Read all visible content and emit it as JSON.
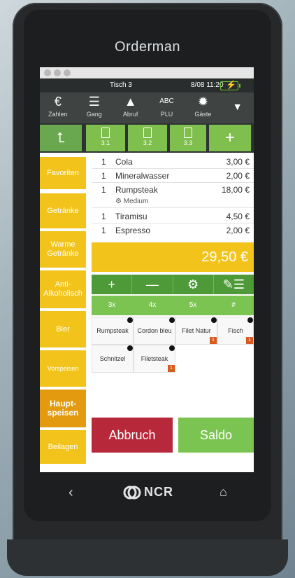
{
  "device": {
    "brand": "Orderman"
  },
  "status": {
    "table": "Tisch 3",
    "time": "8/08  11:20"
  },
  "toolbar": [
    {
      "label": "Zahlen",
      "icon": "euro-icon",
      "glyph": "€"
    },
    {
      "label": "Gang",
      "icon": "list-icon",
      "glyph": "☰"
    },
    {
      "label": "Abruf",
      "icon": "bell-icon",
      "glyph": "🛎"
    },
    {
      "label": "PLU",
      "icon": "abc-icon",
      "glyph": "ABC"
    },
    {
      "label": "Gäste",
      "icon": "guests-icon",
      "glyph": "⚙"
    }
  ],
  "tickets": [
    "3.1",
    "3.2",
    "3.3"
  ],
  "categories": [
    "Favoriten",
    "Getränke",
    "Warme Getränke",
    "Anti-Alkoholisch",
    "Bier",
    "Vorspeisen",
    "Haupt-speisen",
    "Beilagen"
  ],
  "order": [
    {
      "qty": "1",
      "name": "Cola",
      "price": "3,00 €"
    },
    {
      "qty": "1",
      "name": "Mineralwasser",
      "price": "2,00 €"
    },
    {
      "qty": "1",
      "name": "Rumpsteak",
      "price": "18,00 €"
    },
    {
      "qty": "1",
      "name": "Tiramisu",
      "price": "4,50 €"
    },
    {
      "qty": "1",
      "name": "Espresso",
      "price": "2,00 €"
    }
  ],
  "modifier": "Medium",
  "total": "29,50 €",
  "multipliers": [
    "3x",
    "4x",
    "5x",
    "#"
  ],
  "items": [
    {
      "name": "Rumpsteak",
      "badge": ""
    },
    {
      "name": "Cordon bleu",
      "badge": ""
    },
    {
      "name": "Filet Natur",
      "badge": "1"
    },
    {
      "name": "Fisch",
      "badge": "1"
    },
    {
      "name": "Schnitzel",
      "badge": ""
    },
    {
      "name": "Filetsteak",
      "badge": "1"
    }
  ],
  "buttons": {
    "cancel": "Abbruch",
    "saldo": "Saldo"
  },
  "nav": {
    "brand": "NCR"
  }
}
